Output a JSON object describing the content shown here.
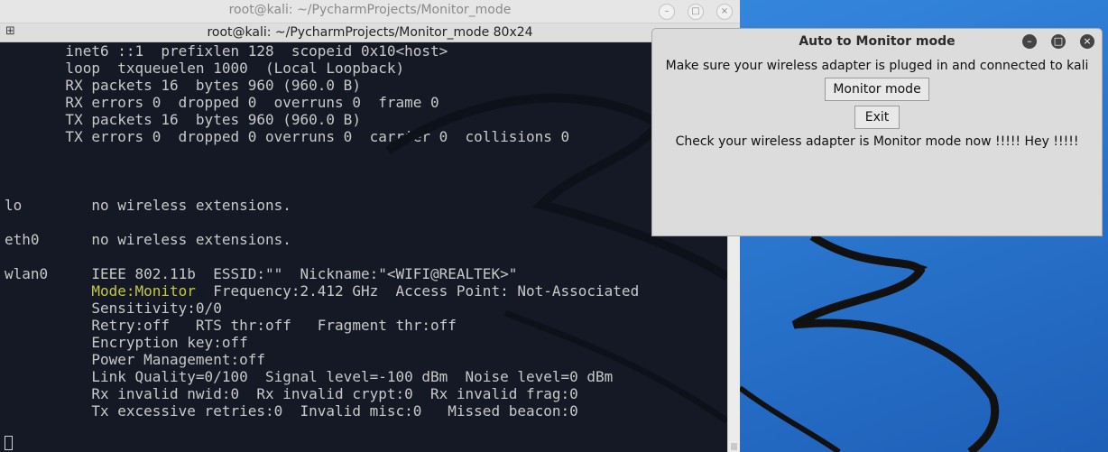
{
  "terminal": {
    "window_title": "root@kali: ~/PycharmProjects/Monitor_mode",
    "tab_title": "root@kali: ~/PycharmProjects/Monitor_mode 80x24",
    "buttons": {
      "minimize": "–",
      "maximize": "□",
      "close": "×"
    },
    "lines": [
      "       inet6 ::1  prefixlen 128  scopeid 0x10<host>",
      "       loop  txqueuelen 1000  (Local Loopback)",
      "       RX packets 16  bytes 960 (960.0 B)",
      "       RX errors 0  dropped 0  overruns 0  frame 0",
      "       TX packets 16  bytes 960 (960.0 B)",
      "       TX errors 0  dropped 0 overruns 0  carrier 0  collisions 0",
      "",
      "",
      "",
      "lo        no wireless extensions.",
      "",
      "eth0      no wireless extensions.",
      "",
      "wlan0     IEEE 802.11b  ESSID:\"\"  Nickname:\"<WIFI@REALTEK>\"",
      "",
      "          Sensitivity:0/0",
      "          Retry:off   RTS thr:off   Fragment thr:off",
      "          Encryption key:off",
      "          Power Management:off",
      "          Link Quality=0/100  Signal level=-100 dBm  Noise level=0 dBm",
      "          Rx invalid nwid:0  Rx invalid crypt:0  Rx invalid frag:0",
      "          Tx excessive retries:0  Invalid misc:0   Missed beacon:0"
    ],
    "mode_line": {
      "indent": "          ",
      "highlight": "Mode:Monitor",
      "rest": "  Frequency:2.412 GHz  Access Point: Not-Associated"
    },
    "colors": {
      "background": "#141925",
      "text": "#c9c9c9",
      "highlight": "#c8c83c"
    }
  },
  "dialog": {
    "title": "Auto to Monitor mode",
    "message": "Make sure your wireless adapter is pluged in and connected to kali",
    "monitor_button": "Monitor mode",
    "exit_button": "Exit",
    "status": "Check your wireless adapter is Monitor mode now !!!!! Hey !!!!!",
    "buttons": {
      "minimize": "–",
      "maximize": "□",
      "close": "×"
    }
  }
}
